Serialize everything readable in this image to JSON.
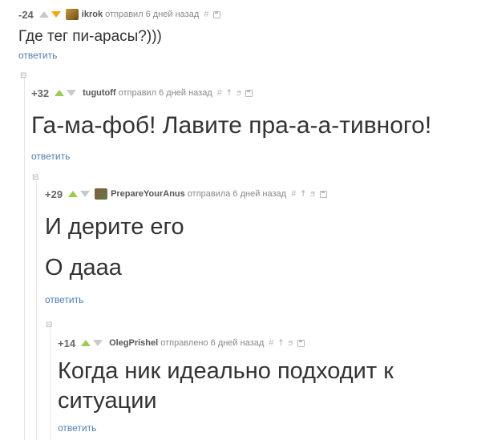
{
  "comments": [
    {
      "rating": "-24",
      "author": "ikrok",
      "action": "отправил",
      "time": "6 дней назад",
      "body": [
        "Где тег пи-арасы?)))"
      ],
      "reply_label": "ответить"
    },
    {
      "rating": "+32",
      "author": "tugutoff",
      "action": "отправил",
      "time": "6 дней назад",
      "body": [
        "Га-ма-фоб! Лавите пра-а-а-тивного!"
      ],
      "reply_label": "ответить"
    },
    {
      "rating": "+29",
      "author": "PrepareYourAnus",
      "action": "отправила",
      "time": "6 дней назад",
      "body": [
        "И дерите его",
        "О дааа"
      ],
      "reply_label": "ответить"
    },
    {
      "rating": "+14",
      "author": "OlegPrishel",
      "action": "отправлено",
      "time": "6 дней назад",
      "body": [
        "Когда ник идеально подходит к",
        "ситуации"
      ],
      "reply_label": "ответить"
    }
  ],
  "collapse_glyph": "⊟",
  "hash_glyph": "#",
  "colors": {
    "upvote": "#9bcb52",
    "downvote": "#f0a519",
    "link": "#4f7dae",
    "neutral_arrow": "#c9c9c9"
  },
  "icons": [
    "hash-icon",
    "figure-icon",
    "pin-icon",
    "save-icon"
  ]
}
